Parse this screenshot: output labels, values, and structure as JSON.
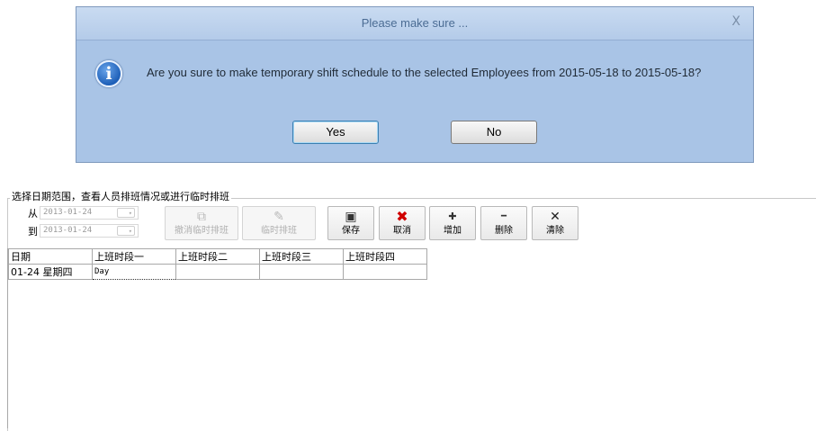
{
  "dialog": {
    "title": "Please make sure ...",
    "close": "X",
    "icon": "info-icon",
    "message": "Are you sure to make temporary shift schedule to the selected Employees from 2015-05-18 to 2015-05-18?",
    "yes_label": "Yes",
    "no_label": "No"
  },
  "panel": {
    "group_label": "选择日期范围，查看人员排班情况或进行临时排班",
    "from_label": "从",
    "from_date": "2013-01-24",
    "to_label": "到",
    "to_date": "2013-01-24",
    "date_drop": "▾"
  },
  "toolbar": {
    "cancel_temp": {
      "label": "撤消临时排班",
      "icon": "cancel-temp-icon",
      "glyph": "⧉"
    },
    "temp_schedule": {
      "label": "临时排班",
      "icon": "edit-icon",
      "glyph": "✎"
    },
    "save": {
      "label": "保存",
      "icon": "save-icon",
      "glyph": "▣"
    },
    "cancel": {
      "label": "取消",
      "icon": "red-x-icon",
      "glyph": "✖"
    },
    "add": {
      "label": "增加",
      "icon": "plus-icon",
      "glyph": "✚"
    },
    "delete": {
      "label": "删除",
      "icon": "minus-icon",
      "glyph": "━"
    },
    "clear": {
      "label": "清除",
      "icon": "x-icon",
      "glyph": "✕"
    }
  },
  "grid": {
    "headers": [
      "日期",
      "上班时段一",
      "上班时段二",
      "上班时段三",
      "上班时段四"
    ],
    "rows": [
      [
        "01-24 星期四",
        "Day",
        "",
        "",
        ""
      ]
    ]
  },
  "colors": {
    "dialog_bg": "#a9c4e6",
    "title_text": "#4b6c94",
    "cancel_red": "#d00000"
  }
}
